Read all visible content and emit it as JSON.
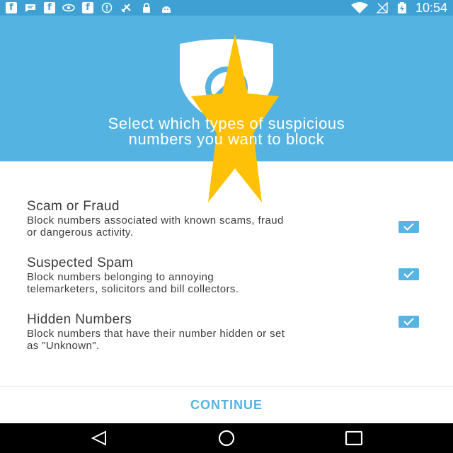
{
  "status_bar": {
    "time": "10:54",
    "icons_left": [
      "facebook-icon",
      "message-icon",
      "facebook-icon",
      "eye-icon",
      "facebook-icon",
      "alert-icon",
      "satellite-icon",
      "lock-icon",
      "android-icon"
    ],
    "icons_right": [
      "wifi-icon",
      "no-signal-icon",
      "battery-icon"
    ]
  },
  "header": {
    "title_line1": "Select which types of suspicious",
    "title_line2": "numbers you want to block",
    "icon": "shield-icon",
    "overlay": "star-icon"
  },
  "options": [
    {
      "title": "Scam or Fraud",
      "desc_line1": "Block numbers associated with known scams, fraud",
      "desc_line2": "or dangerous activity.",
      "checked": true
    },
    {
      "title": "Suspected Spam",
      "desc_line1": "Block numbers belonging to annoying",
      "desc_line2": "telemarketers, solicitors and bill collectors.",
      "checked": true
    },
    {
      "title": "Hidden Numbers",
      "desc_line1": "Block numbers that have their number hidden or set",
      "desc_line2": "as \"Unknown\".",
      "checked": true
    }
  ],
  "continue_label": "CONTINUE",
  "nav": {
    "back": "back-icon",
    "home": "home-icon",
    "recents": "recents-icon"
  },
  "colors": {
    "header_bg": "#55b3e2",
    "status_bg": "#3fa0d4",
    "accent": "#55b3e2",
    "star": "#ffc107"
  }
}
